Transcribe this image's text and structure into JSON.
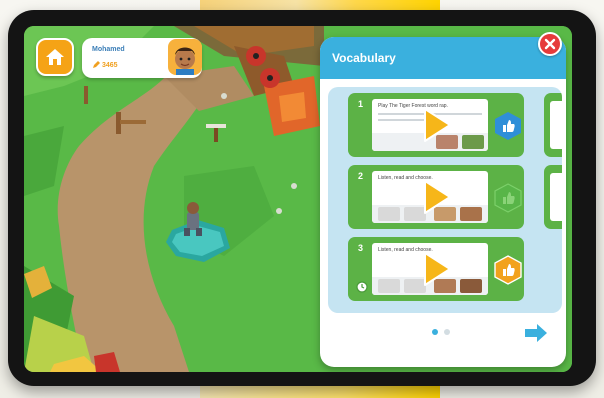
{
  "player": {
    "name": "Mohamed",
    "points": "3465"
  },
  "panel": {
    "title": "Vocabulary"
  },
  "activities": [
    {
      "number": "1",
      "instruction": "Play The Tiger Forest word rap.",
      "badge": "blue-hexagon-thumb-icon",
      "status_color": "#2f8fd8"
    },
    {
      "number": "2",
      "instruction": "Listen, read and choose.",
      "badge": "green-hexagon-thumb-icon",
      "status_color": "#58b548"
    },
    {
      "number": "3",
      "instruction": "Listen, read and choose.",
      "badge": "orange-hexagon-thumb-icon",
      "status_color": "#f2a21c"
    }
  ],
  "pager": {
    "current_page": 1,
    "total_pages": 2
  },
  "colors": {
    "accent_blue": "#3ab0de",
    "card_green": "#5cb246",
    "play_yellow": "#f6b619",
    "home_orange": "#f5a316",
    "close_red": "#e63b3b"
  }
}
